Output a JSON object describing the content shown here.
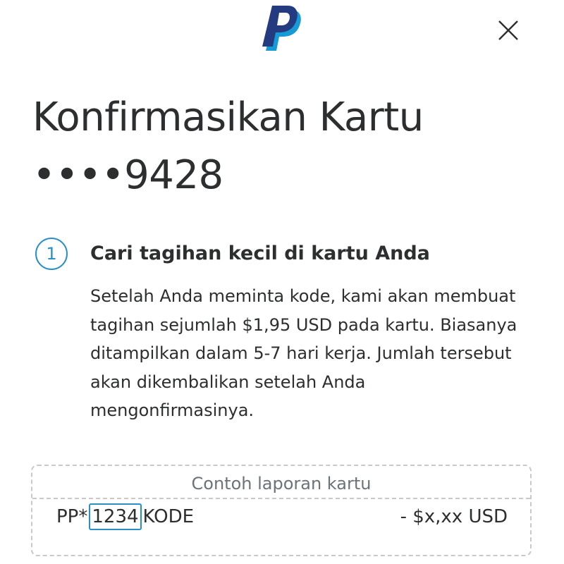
{
  "header": {
    "logo_name": "PayPal",
    "close_icon": "close-icon"
  },
  "title": {
    "text": "Konfirmasikan Kartu",
    "card_mask": "••••9428"
  },
  "step": {
    "number": "1",
    "heading": "Cari tagihan kecil di kartu Anda",
    "body": "Setelah Anda meminta kode, kami akan membuat tagihan sejumlah $1,95 USD pada kartu. Biasanya ditampilkan dalam 5-7 hari kerja. Jumlah tersebut akan dikembalikan setelah Anda mengonfirmasinya."
  },
  "statement_example": {
    "title": "Contoh laporan kartu",
    "prefix": "PP*",
    "code": "1234",
    "suffix": "KODE",
    "amount": "- $x,xx USD"
  },
  "colors": {
    "accent": "#2a8fc4",
    "paypal_dark": "#253b80",
    "paypal_light": "#179bd7",
    "text": "#2c2e2f",
    "muted": "#6c7378"
  }
}
